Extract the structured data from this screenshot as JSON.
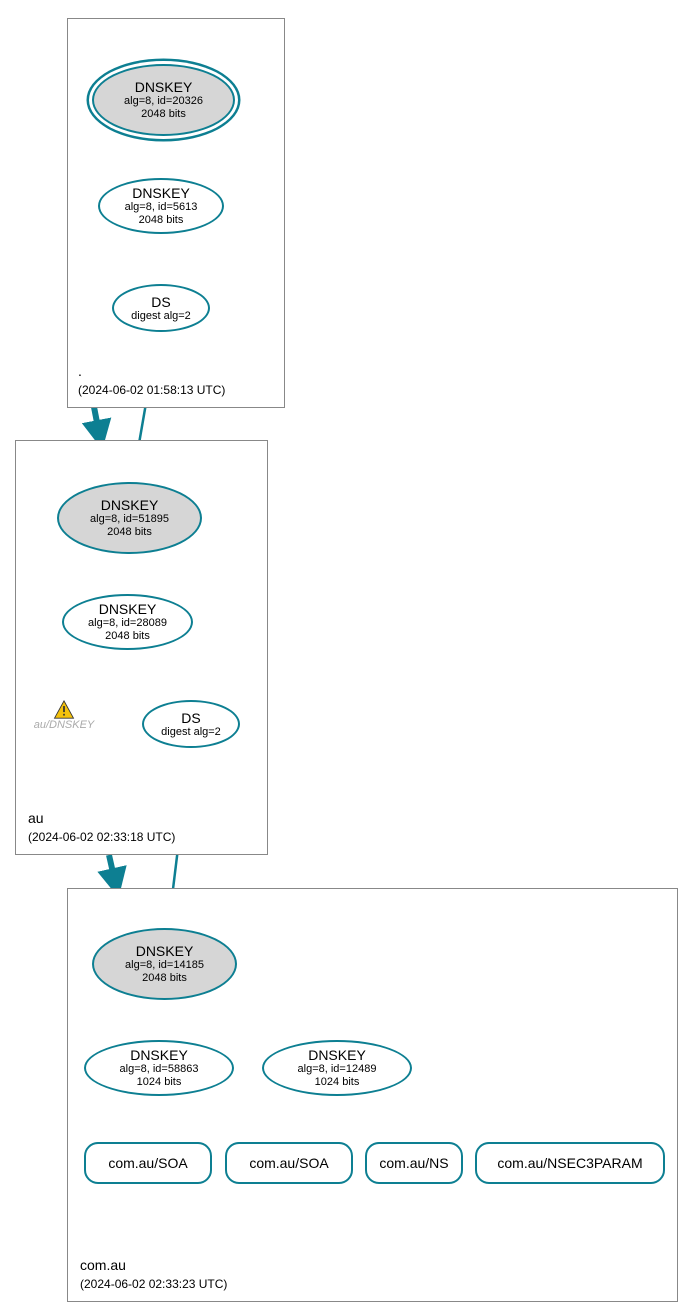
{
  "colors": {
    "stroke": "#0d7f92",
    "secure_fill": "#d6d6d6",
    "box_border": "#888888"
  },
  "zones": [
    {
      "name": ".",
      "date": "(2024-06-02 01:58:13 UTC)"
    },
    {
      "name": "au",
      "date": "(2024-06-02 02:33:18 UTC)"
    },
    {
      "name": "com.au",
      "date": "(2024-06-02 02:33:23 UTC)"
    }
  ],
  "nodes": {
    "root_ksk": {
      "title": "DNSKEY",
      "sub1": "alg=8, id=20326",
      "sub2": "2048 bits"
    },
    "root_zsk": {
      "title": "DNSKEY",
      "sub1": "alg=8, id=5613",
      "sub2": "2048 bits"
    },
    "root_ds": {
      "title": "DS",
      "sub1": "digest alg=2"
    },
    "au_ksk": {
      "title": "DNSKEY",
      "sub1": "alg=8, id=51895",
      "sub2": "2048 bits"
    },
    "au_zsk": {
      "title": "DNSKEY",
      "sub1": "alg=8, id=28089",
      "sub2": "2048 bits"
    },
    "au_ds": {
      "title": "DS",
      "sub1": "digest alg=2"
    },
    "comau_ksk": {
      "title": "DNSKEY",
      "sub1": "alg=8, id=14185",
      "sub2": "2048 bits"
    },
    "comau_zsk1": {
      "title": "DNSKEY",
      "sub1": "alg=8, id=58863",
      "sub2": "1024 bits"
    },
    "comau_zsk2": {
      "title": "DNSKEY",
      "sub1": "alg=8, id=12489",
      "sub2": "1024 bits"
    },
    "rr_soa1": {
      "label": "com.au/SOA"
    },
    "rr_soa2": {
      "label": "com.au/SOA"
    },
    "rr_ns": {
      "label": "com.au/NS"
    },
    "rr_nsec3param": {
      "label": "com.au/NSEC3PARAM"
    }
  },
  "warning": {
    "label": "au/DNSKEY"
  }
}
